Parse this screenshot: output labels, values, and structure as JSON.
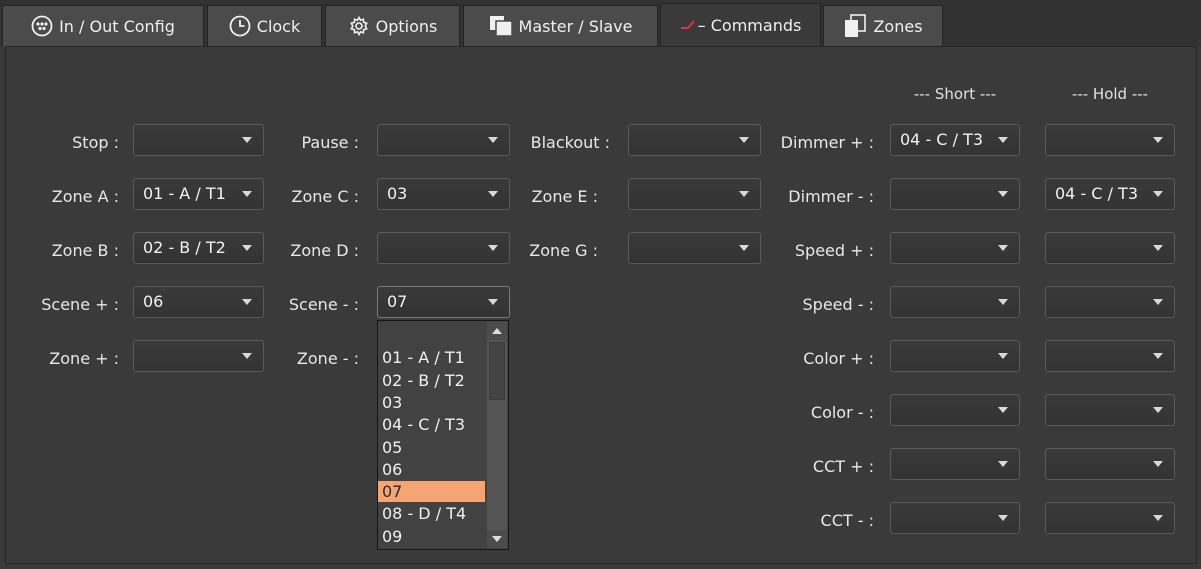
{
  "tabs": [
    {
      "label": "In / Out Config",
      "icon": "dmx-connector-icon"
    },
    {
      "label": "Clock",
      "icon": "clock-icon"
    },
    {
      "label": "Options",
      "icon": "gear-icon"
    },
    {
      "label": "Master / Slave",
      "icon": "master-slave-icon"
    },
    {
      "label": "Commands",
      "icon": "commands-icon",
      "prefix": "– "
    },
    {
      "label": "Zones",
      "icon": "zones-icon"
    }
  ],
  "active_tab": "Commands",
  "headers": {
    "short": "--- Short ---",
    "hold": "--- Hold ---"
  },
  "fields": {
    "stop": {
      "label": "Stop :",
      "value": ""
    },
    "pause": {
      "label": "Pause :",
      "value": ""
    },
    "blackout": {
      "label": "Blackout :",
      "value": ""
    },
    "zone_a": {
      "label": "Zone A :",
      "value": "01 - A / T1"
    },
    "zone_c": {
      "label": "Zone C :",
      "value": "03"
    },
    "zone_e": {
      "label": "Zone E :",
      "value": ""
    },
    "zone_b": {
      "label": "Zone B :",
      "value": "02 - B / T2"
    },
    "zone_d": {
      "label": "Zone D :",
      "value": ""
    },
    "zone_g": {
      "label": "Zone G :",
      "value": ""
    },
    "scene_plus": {
      "label": "Scene + :",
      "value": "06"
    },
    "scene_minus": {
      "label": "Scene - :",
      "value": "07"
    },
    "zone_plus": {
      "label": "Zone + :",
      "value": ""
    },
    "zone_minus": {
      "label": "Zone - :",
      "value": ""
    }
  },
  "right_rows": [
    {
      "label": "Dimmer + :",
      "short": "04 - C / T3",
      "hold": ""
    },
    {
      "label": "Dimmer - :",
      "short": "",
      "hold": "04 - C / T3"
    },
    {
      "label": "Speed + :",
      "short": "",
      "hold": ""
    },
    {
      "label": "Speed - :",
      "short": "",
      "hold": ""
    },
    {
      "label": "Color + :",
      "short": "",
      "hold": ""
    },
    {
      "label": "Color - :",
      "short": "",
      "hold": ""
    },
    {
      "label": "CCT + :",
      "short": "",
      "hold": ""
    },
    {
      "label": "CCT - :",
      "short": "",
      "hold": ""
    }
  ],
  "dropdown": {
    "options": [
      "",
      "01 - A / T1",
      "02 - B / T2",
      "03",
      "04 - C / T3",
      "05",
      "06",
      "07",
      "08 - D / T4",
      "09"
    ],
    "selected": "07",
    "highlight_color": "#f4a573"
  },
  "colors": {
    "background": "#3a3a3a",
    "tab": "#4b4b4b",
    "accent": "#f4a573",
    "commands_icon": "#e0303a"
  }
}
